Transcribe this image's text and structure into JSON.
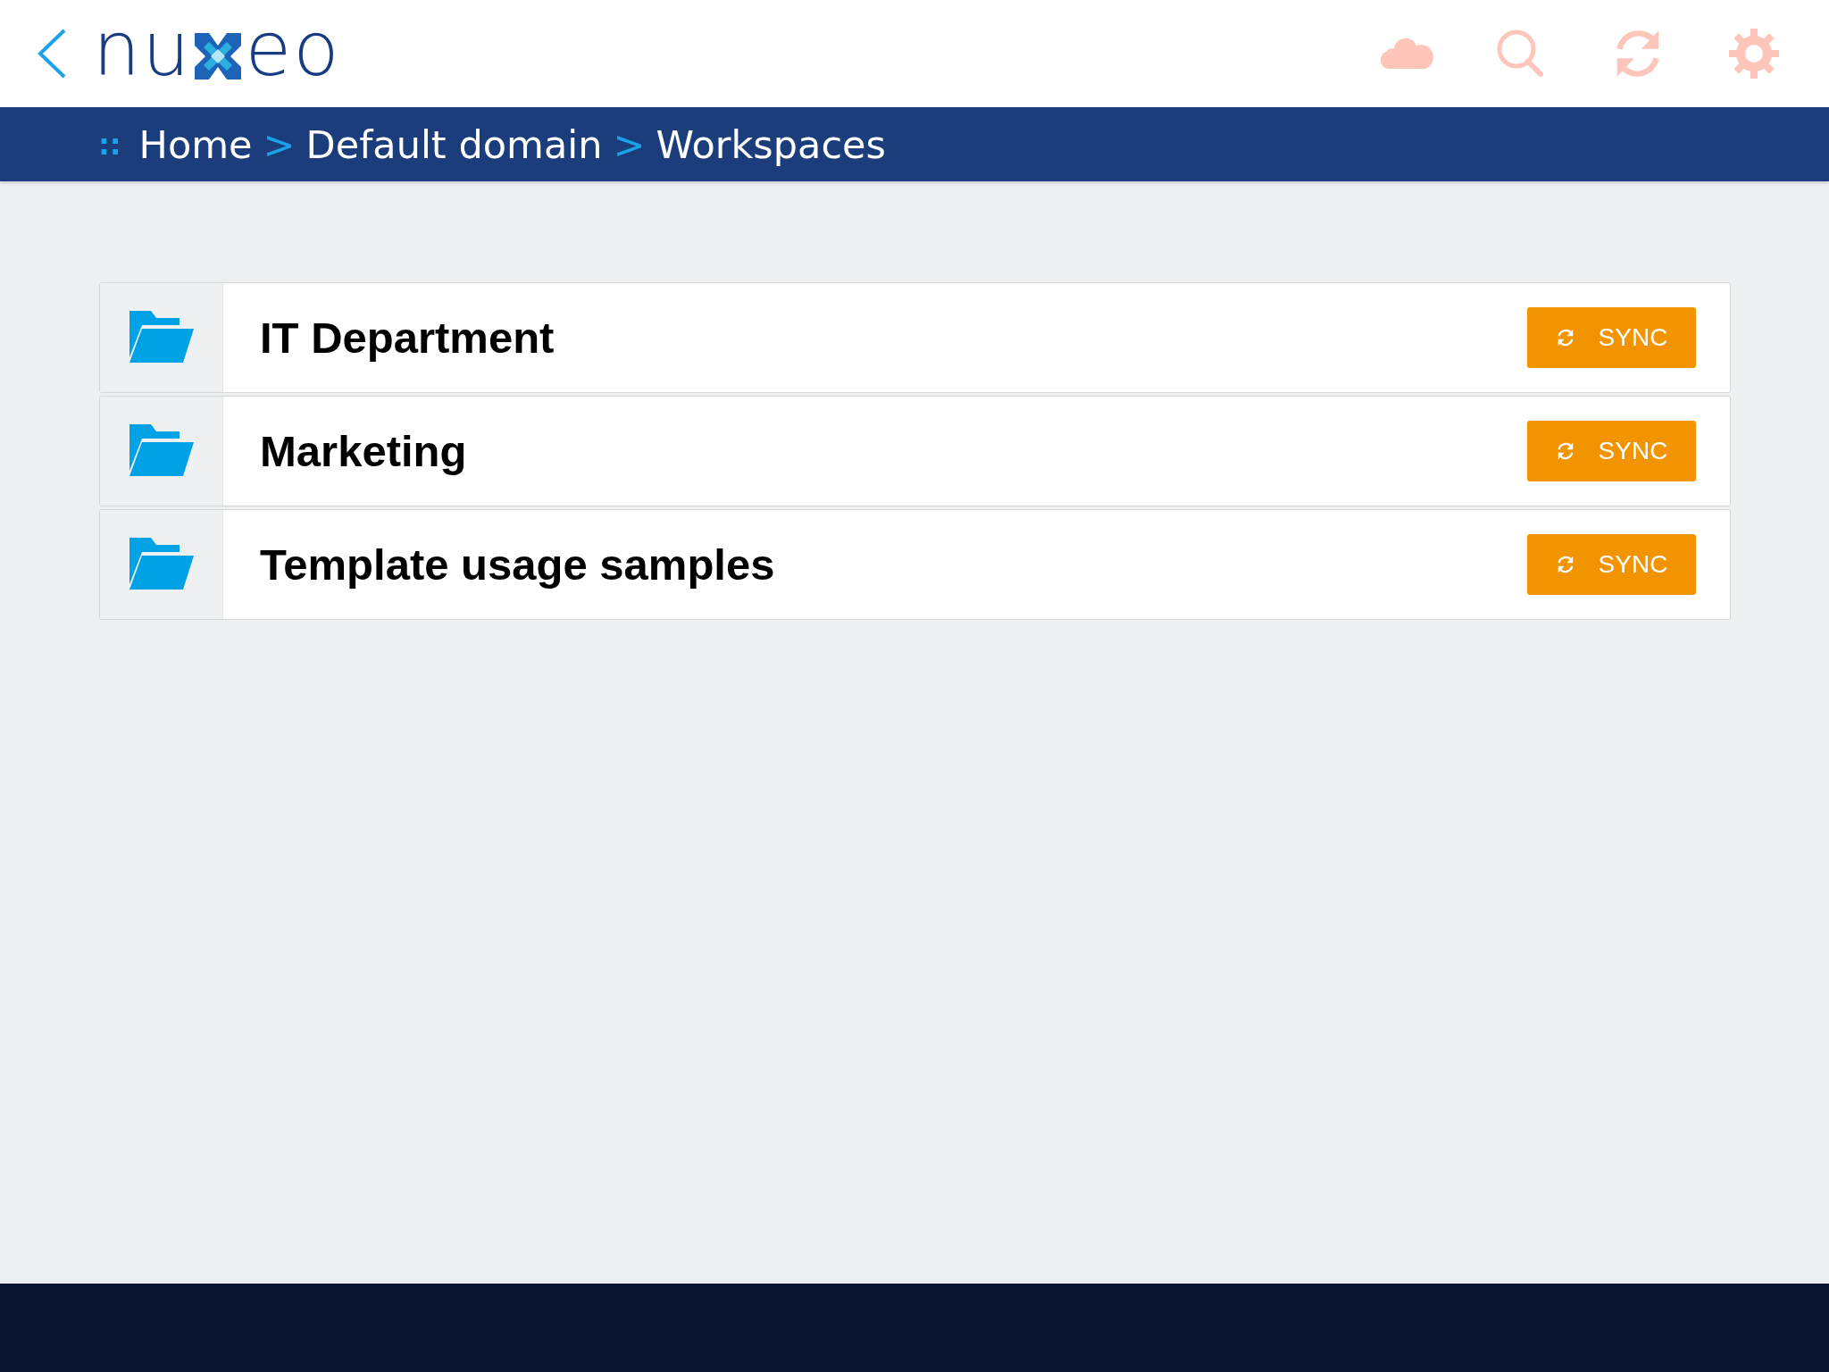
{
  "header": {
    "logo": {
      "before": "nu",
      "after": "eo"
    }
  },
  "breadcrumb": {
    "marker": "::",
    "separator": ">",
    "items": [
      "Home",
      "Default domain",
      "Workspaces"
    ]
  },
  "workspaces": [
    {
      "title": "IT Department",
      "action": "SYNC"
    },
    {
      "title": "Marketing",
      "action": "SYNC"
    },
    {
      "title": "Template usage samples",
      "action": "SYNC"
    }
  ]
}
